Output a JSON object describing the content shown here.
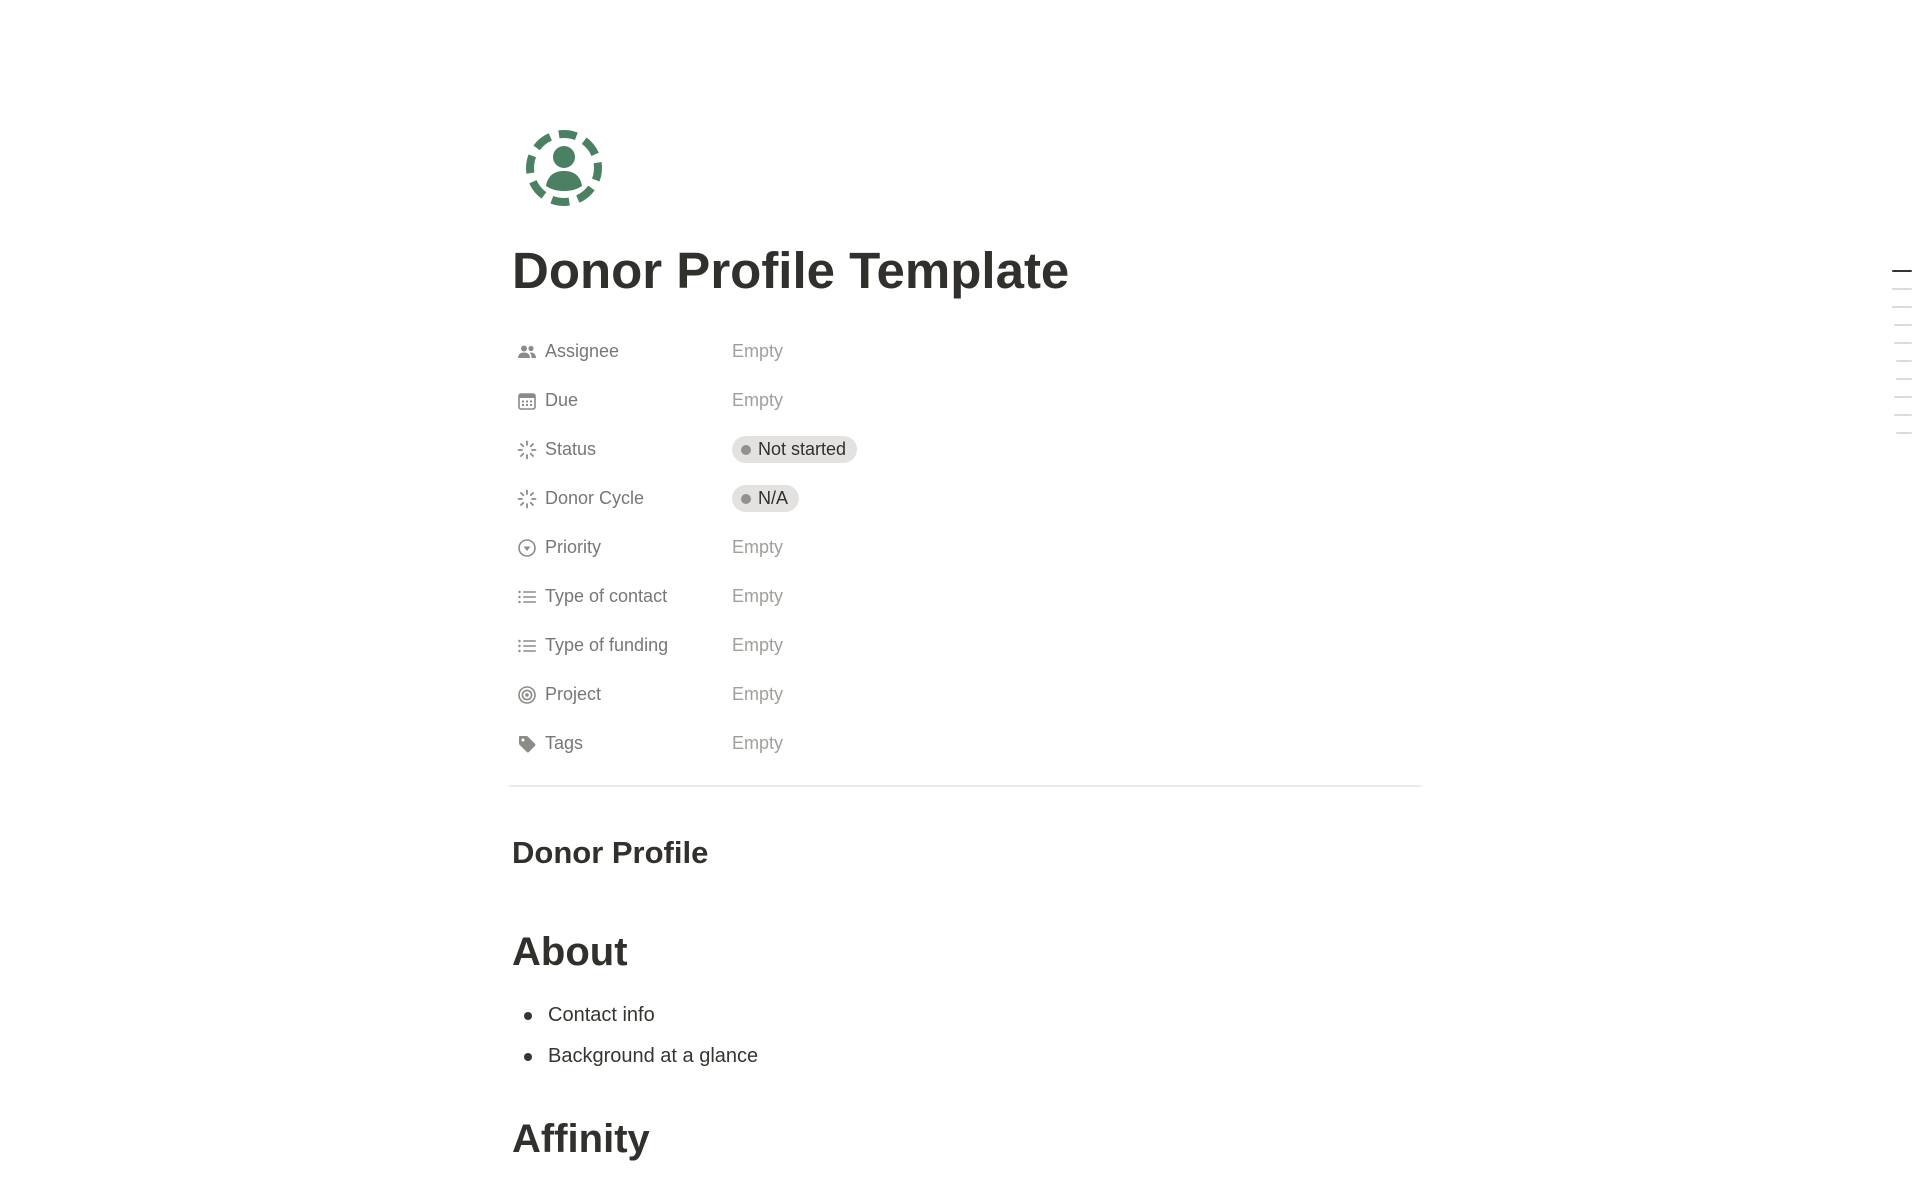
{
  "page": {
    "title": "Donor Profile Template",
    "icon": "donor-profile-icon",
    "accent_color": "#4b8063"
  },
  "properties": [
    {
      "name": "Assignee",
      "icon": "people-icon",
      "value": "Empty",
      "type": "empty"
    },
    {
      "name": "Due",
      "icon": "calendar-icon",
      "value": "Empty",
      "type": "empty"
    },
    {
      "name": "Status",
      "icon": "status-icon",
      "value": "Not started",
      "type": "pill"
    },
    {
      "name": "Donor Cycle",
      "icon": "status-icon",
      "value": "N/A",
      "type": "pill"
    },
    {
      "name": "Priority",
      "icon": "select-icon",
      "value": "Empty",
      "type": "empty"
    },
    {
      "name": "Type of contact",
      "icon": "list-icon",
      "value": "Empty",
      "type": "empty"
    },
    {
      "name": "Type of funding",
      "icon": "list-icon",
      "value": "Empty",
      "type": "empty"
    },
    {
      "name": "Project",
      "icon": "target-icon",
      "value": "Empty",
      "type": "empty"
    },
    {
      "name": "Tags",
      "icon": "tag-icon",
      "value": "Empty",
      "type": "empty"
    }
  ],
  "body": {
    "donor_profile_heading": "Donor Profile",
    "about_heading": "About",
    "about_items": [
      "Contact info",
      "Background at a glance"
    ],
    "affinity_heading": "Affinity"
  },
  "colors": {
    "text": "#37352f",
    "muted": "#787774",
    "placeholder": "#a19f9a",
    "pill_bg": "#e3e2e0",
    "pill_dot": "#91918e"
  }
}
